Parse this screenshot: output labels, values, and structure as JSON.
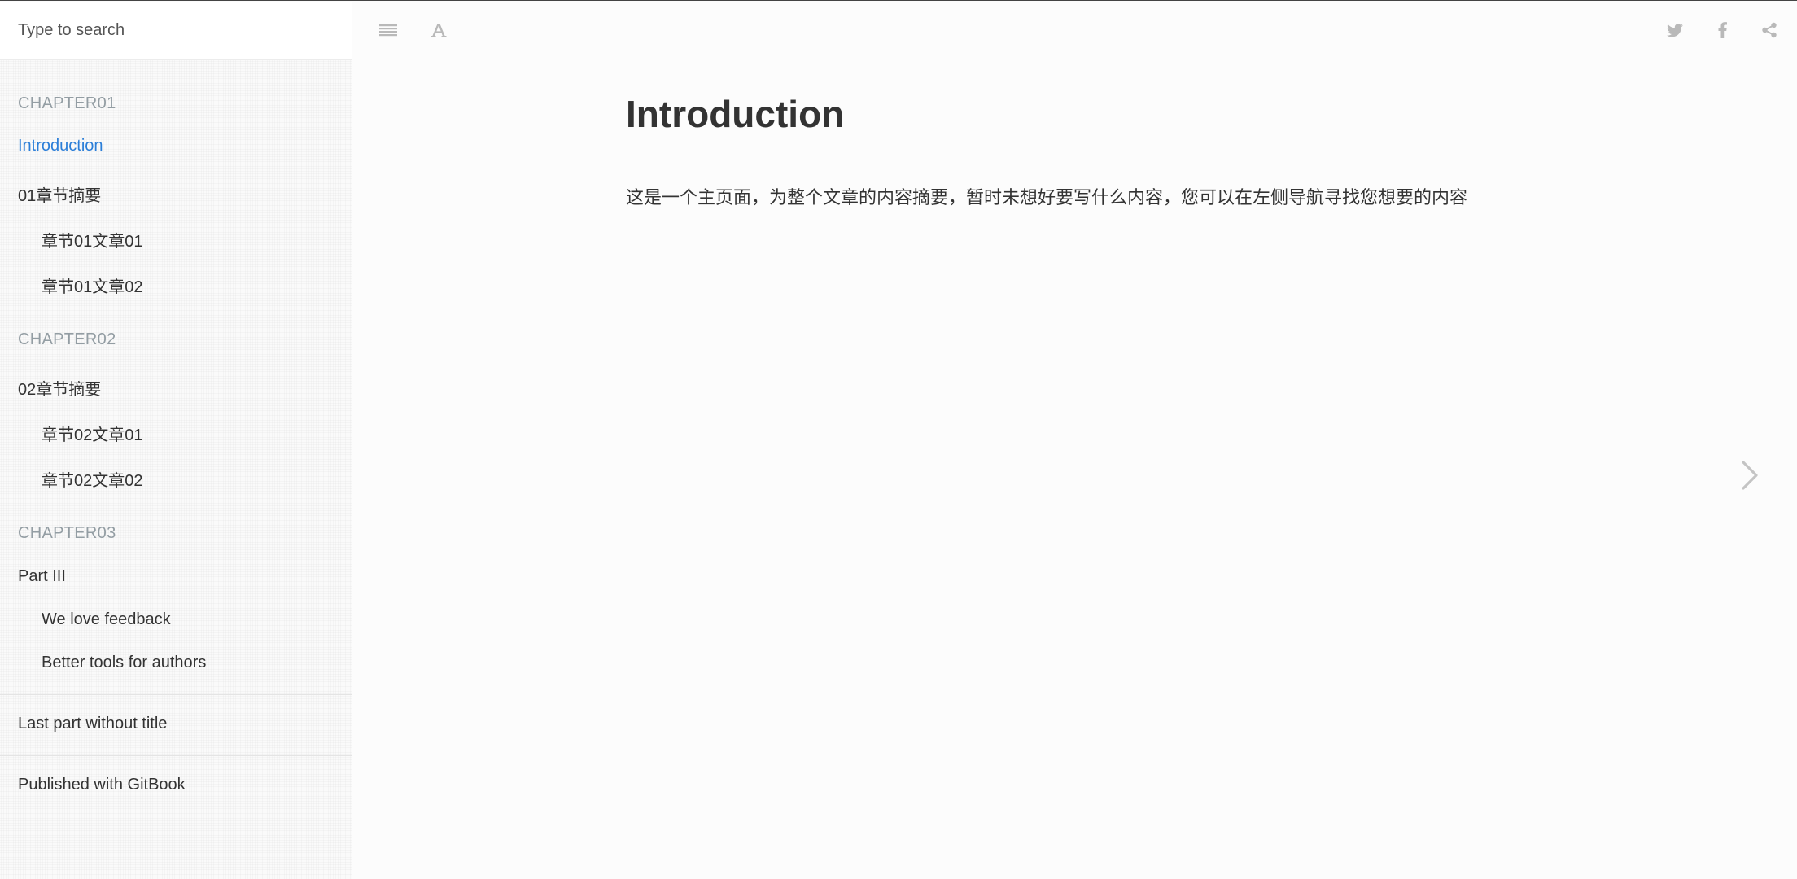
{
  "sidebar": {
    "search": {
      "placeholder": "Type to search"
    },
    "chapters": [
      {
        "header": "CHAPTER01",
        "items": [
          {
            "label": "Introduction",
            "level": 1,
            "active": true
          },
          {
            "label": "01章节摘要",
            "level": 1
          },
          {
            "label": "章节01文章01",
            "level": 2
          },
          {
            "label": "章节01文章02",
            "level": 2
          }
        ]
      },
      {
        "header": "CHAPTER02",
        "items": [
          {
            "label": "02章节摘要",
            "level": 1
          },
          {
            "label": "章节02文章01",
            "level": 2
          },
          {
            "label": "章节02文章02",
            "level": 2
          }
        ]
      },
      {
        "header": "CHAPTER03",
        "items": [
          {
            "label": "Part III",
            "level": 1
          },
          {
            "label": "We love feedback",
            "level": 2
          },
          {
            "label": "Better tools for authors",
            "level": 2
          }
        ]
      }
    ],
    "last_part": "Last part without title",
    "published": "Published with GitBook"
  },
  "toolbar": {
    "left_icons": [
      "menu-icon",
      "font-settings-icon"
    ],
    "right_icons": [
      "twitter-icon",
      "facebook-icon",
      "share-icon"
    ],
    "icon_color": "#b9b9b9"
  },
  "page": {
    "title": "Introduction",
    "paragraph": "这是一个主页面，为整个文章的内容摘要，暂时未想好要写什么内容，您可以在左侧导航寻找您想要的内容"
  },
  "colors": {
    "accent": "#2b7ed8",
    "chapter_header": "#939da3",
    "text": "#333333"
  }
}
